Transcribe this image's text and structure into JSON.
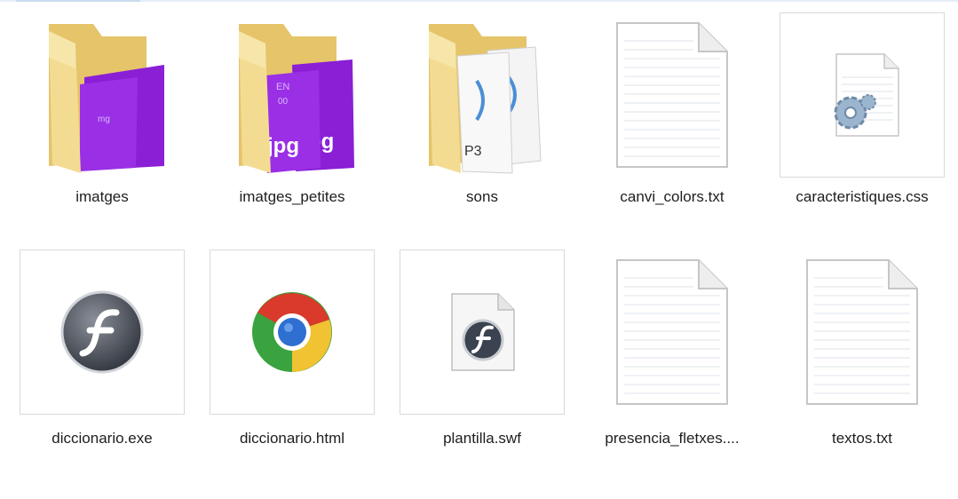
{
  "items": [
    {
      "name": "imatges",
      "icon": "folder-images-icon"
    },
    {
      "name": "imatges_petites",
      "icon": "folder-images-icon"
    },
    {
      "name": "sons",
      "icon": "folder-audio-icon"
    },
    {
      "name": "canvi_colors.txt",
      "icon": "text-file-icon"
    },
    {
      "name": "caracteristiques.css",
      "icon": "css-file-icon"
    },
    {
      "name": "diccionario.exe",
      "icon": "flash-app-icon"
    },
    {
      "name": "diccionario.html",
      "icon": "chrome-html-icon"
    },
    {
      "name": "plantilla.swf",
      "icon": "swf-file-icon"
    },
    {
      "name": "presencia_fletxes....",
      "icon": "text-file-icon"
    },
    {
      "name": "textos.txt",
      "icon": "text-file-icon"
    }
  ],
  "thumb_text": {
    "jpg": "jpg",
    "pg": "pg",
    "mp3": "P3",
    "mp3b": "3"
  },
  "colors": {
    "folder": "#f2d98a",
    "folder_dark": "#e0c06a",
    "purple": "#8a1fd6",
    "border": "#d9d9d9"
  }
}
